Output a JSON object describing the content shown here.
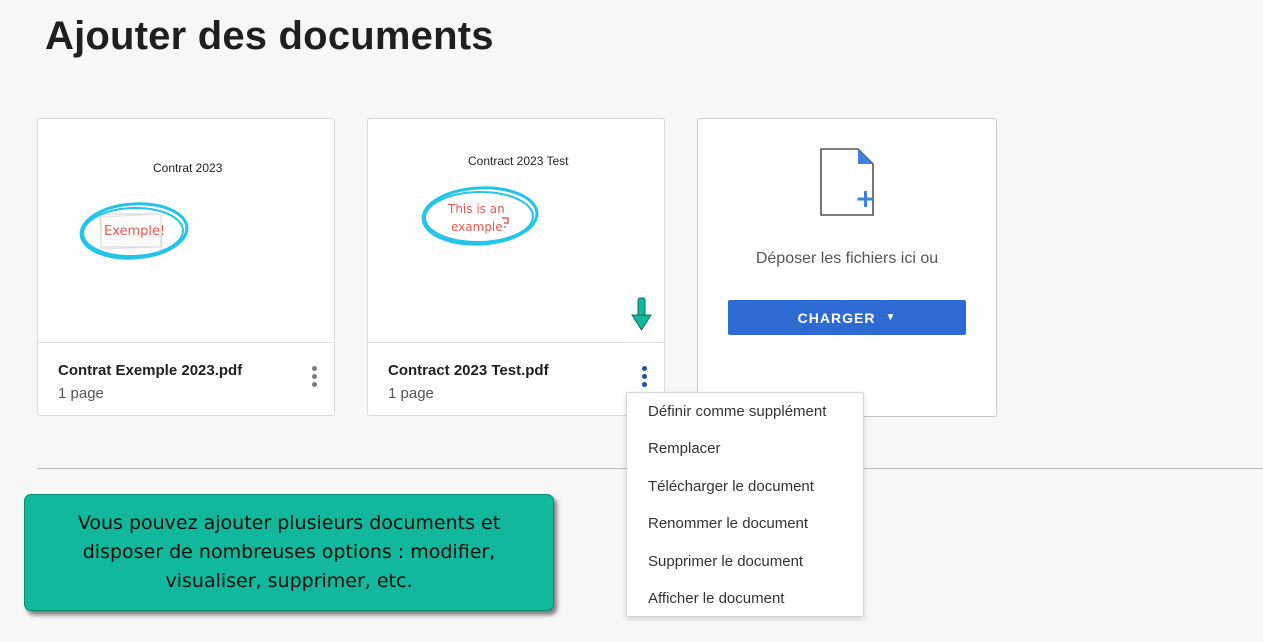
{
  "page": {
    "title": "Ajouter des documents"
  },
  "documents": [
    {
      "preview_heading": "Contrat 2023",
      "preview_annotation": "Exemple!",
      "file_name": "Contrat Exemple 2023.pdf",
      "page_count": "1 page"
    },
    {
      "preview_heading": "Contract 2023 Test",
      "preview_annotation_line1": "This is an",
      "preview_annotation_line2": "example",
      "file_name": "Contract 2023 Test.pdf",
      "page_count": "1 page"
    }
  ],
  "upload": {
    "drop_text": "Déposer les fichiers ici ou",
    "button_label": "CHARGER",
    "caret": "▼"
  },
  "context_menu": {
    "items": [
      "Définir comme supplément",
      "Remplacer",
      "Télécharger le document",
      "Renommer le document",
      "Supprimer le document",
      "Afficher le document"
    ]
  },
  "callout": {
    "text": "Vous pouvez ajouter plusieurs documents et\ndisposer de nombreuses options : modifier,\nvisualiser, supprimer, etc."
  },
  "colors": {
    "accent": "#2d6bd3",
    "callout_bg": "#12b89b",
    "circle": "#22c4ea",
    "handwriting": "#e85a4f",
    "kebab_active": "#1f4fa8",
    "kebab_default": "#7a7a7a"
  },
  "icons": [
    "file-add-icon",
    "kebab-menu-icon",
    "down-arrow-icon",
    "caret-down-icon"
  ]
}
